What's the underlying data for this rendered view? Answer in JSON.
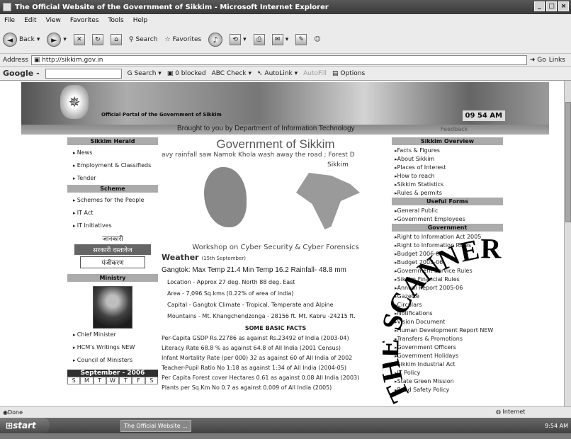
{
  "window": {
    "title": "The Official Website of the Government of Sikkim - Microsoft Internet Explorer"
  },
  "menu": [
    "File",
    "Edit",
    "View",
    "Favorites",
    "Tools",
    "Help"
  ],
  "toolbar": {
    "back": "Back",
    "search": "Search",
    "favorites": "Favorites"
  },
  "address": {
    "label": "Address",
    "url": "http://sikkim.gov.in",
    "go": "Go",
    "links": "Links"
  },
  "google": {
    "logo": "Google -",
    "search": "Search",
    "blocked": "0 blocked",
    "check": "Check",
    "autolink": "AutoLink",
    "autofill": "AutoFill",
    "options": "Options"
  },
  "banner": {
    "portal": "Official Portal of the Government of Sikkim",
    "clock": "09 54 AM",
    "brought": "Brought to you by Department of Information Technology",
    "feedback": "Feedback"
  },
  "left": {
    "herald_header": "Sikkim Herald",
    "herald_items": [
      "News",
      "Employment & Classifieds",
      "Tender"
    ],
    "scheme_header": "Scheme",
    "scheme_items": [
      "Schemes for the People",
      "IT Act",
      "IT Initiatives"
    ],
    "hindi": [
      "जानकारी",
      "सरकारी दस्तावेज",
      "पंजीकरण"
    ],
    "ministry_header": "Ministry",
    "ministry_items": [
      "Chief Minister",
      "HCM's Writings NEW",
      "Council of Ministers"
    ],
    "calendar": {
      "month": "September - 2006",
      "days": [
        "S",
        "M",
        "T",
        "W",
        "T",
        "F",
        "S"
      ]
    }
  },
  "center": {
    "title": "Government of Sikkim",
    "ticker": "avy rainfall saw Namok Khola wash away the road ; Forest D",
    "map_label": "Sikkim",
    "workshop": "Workshop on Cyber Security & Cyber Forensics",
    "weather": "Weather",
    "weather_date": "(15th September)",
    "gangtok": "Gangtok: Max Temp 21.4 Min Temp 16.2 Rainfall- 48.8 mm",
    "info": [
      "Location - Approx 27 deg. North 88 deg. East",
      "Area - 7,096 Sq.kms (0.22% of area of India)",
      "Capital - Gangtok Climate - Tropical, Temperate and Alpine",
      "Mountains - Mt. Khangchendzonga - 28156 ft. Mt. Kabru -24215 ft."
    ],
    "facts_header": "SOME BASIC FACTS",
    "facts": [
      "Per-Capita GSDP Rs.22786 as against Rs.23492 of India (2003-04)",
      "Literacy Rate 68.8 % as against 64.8 of All India (2001 Census)",
      "Infant Mortality Rate (per 000) 32 as against 60 of All India of 2002",
      "Teacher-Pupil Ratio No 1:18 as against 1:34 of All India (2004-05)",
      "Per Capita Forest cover Hectares 0.61 as against 0.08 All India (2003)",
      "Plants per Sq.Km No 0.7 as against 0.009 of All India (2005)"
    ]
  },
  "right": {
    "overview_header": "Sikkim Overview",
    "overview_items": [
      "Facts & Figures",
      "About Sikkim",
      "Places of Interest",
      "How to reach",
      "Sikkim Statistics",
      "Rules & permits"
    ],
    "forms_header": "Useful Forms",
    "forms_items": [
      "General Public",
      "Government Employees"
    ],
    "gov_header": "Government",
    "gov_items": [
      "Right to Information Act 2005",
      "Right to Information Rules",
      "Budget 2006-07",
      "Budget 2005-06",
      "Government Service Rules",
      "Sikkim Financial Rules",
      "Annual Report 2005-06",
      "Gazette",
      "Circulars",
      "Notifications",
      "Vision Document",
      "Human Development Report NEW",
      "Transfers & Promotions",
      "Government Officers",
      "Government Holidays",
      "Sikkim Industrial Act",
      "IT Policy",
      "State Green Mission",
      "Road Safety Policy"
    ]
  },
  "stamp": "THE SCANNER",
  "status": {
    "text": "Done",
    "zone": "Internet"
  },
  "taskbar": {
    "start": "start",
    "task": "The Official Website ...",
    "clock": "9:54 AM"
  }
}
